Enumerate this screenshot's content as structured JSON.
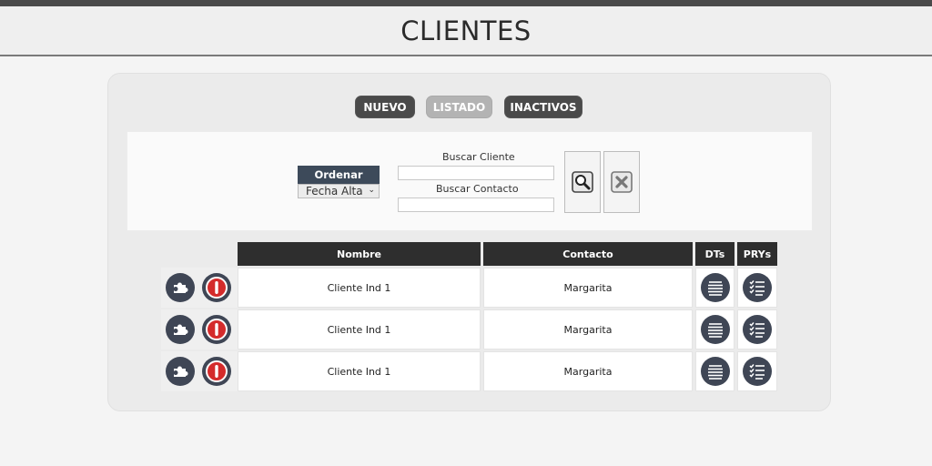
{
  "header": {
    "title": "CLIENTES"
  },
  "toolbar": {
    "nuevo_label": "NUEVO",
    "listado_label": "LISTADO",
    "inactivos_label": "INACTIVOS"
  },
  "search": {
    "order_label": "Ordenar",
    "order_value": "Fecha Alta",
    "cliente_label": "Buscar Cliente",
    "contacto_label": "Buscar Contacto",
    "cliente_value": "",
    "contacto_value": ""
  },
  "table": {
    "headers": {
      "nombre": "Nombre",
      "contacto": "Contacto",
      "dts": "DTs",
      "prys": "PRYs"
    },
    "rows": [
      {
        "nombre": "Cliente Ind 1",
        "contacto": "Margarita"
      },
      {
        "nombre": "Cliente Ind 1",
        "contacto": "Margarita"
      },
      {
        "nombre": "Cliente Ind 1",
        "contacto": "Margarita"
      }
    ]
  },
  "icons": {
    "puzzle": "puzzle-icon",
    "deactivate": "deactivate-icon",
    "dts": "document-lines-icon",
    "prys": "checklist-icon",
    "search": "magnifier-icon",
    "clear": "clear-x-icon"
  },
  "colors": {
    "header_bg": "#2e2e2e",
    "order_bg": "#3d4a5a",
    "danger": "#d42b2b",
    "icon_circle": "#3f4655"
  }
}
